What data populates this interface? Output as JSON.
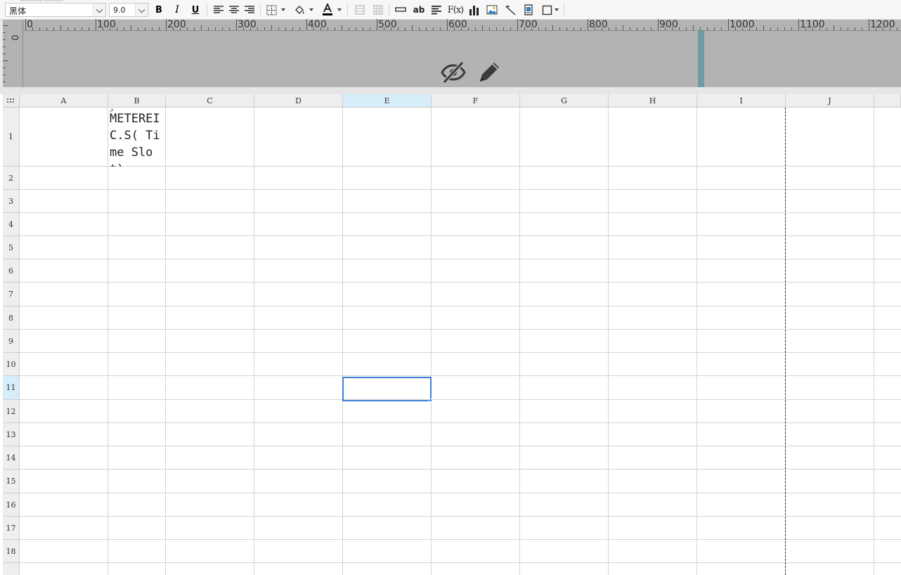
{
  "toolbar": {
    "font_name": "黑体",
    "font_size": "9.0",
    "bold_label": "B",
    "italic_label": "I",
    "underline_label": "U",
    "text_tool_label": "ab",
    "formula_label": "F(x)",
    "font_color": "#000000"
  },
  "ruler": {
    "labels": [
      "0",
      "100",
      "200",
      "300",
      "400",
      "500",
      "600",
      "700",
      "800",
      "900",
      "1000",
      "1100",
      "1200"
    ],
    "vertical_label": "0"
  },
  "grid": {
    "columns": [
      "A",
      "B",
      "C",
      "D",
      "E",
      "F",
      "G",
      "H",
      "I",
      "J"
    ],
    "rows": [
      "1",
      "2",
      "3",
      "4",
      "5",
      "6",
      "7",
      "8",
      "9",
      "10",
      "11",
      "12",
      "13",
      "14",
      "15",
      "16",
      "17",
      "18"
    ],
    "selected_column": "E",
    "selected_row": "11",
    "cell_b1_text": "METEREIC.S( Time Slot)",
    "cell_b1_marker": "↗"
  },
  "colors": {
    "accent": "#3a7fd8",
    "header_selected": "#d6eefa",
    "band_background": "#b3b3b3",
    "band_marker": "#6f9aa6"
  }
}
